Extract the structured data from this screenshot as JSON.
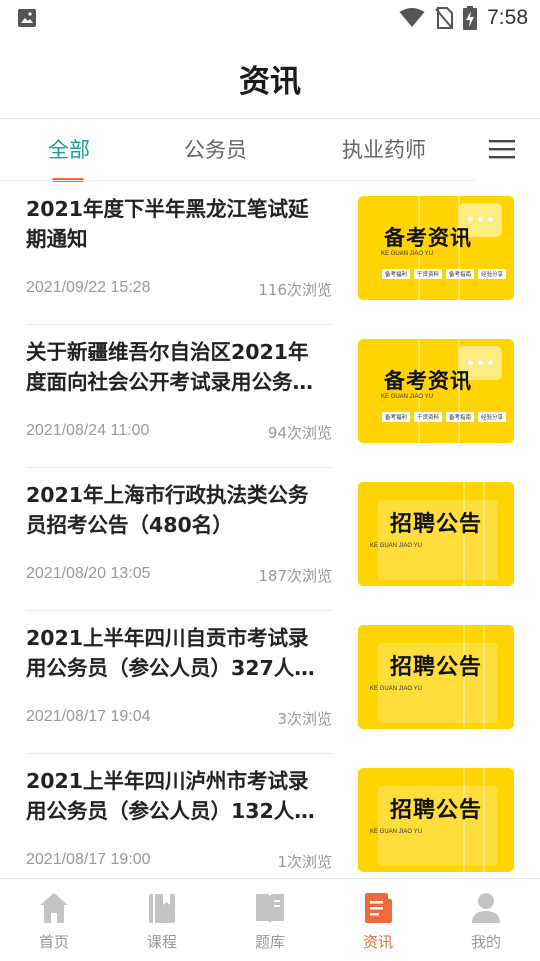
{
  "status_bar": {
    "time": "7:58"
  },
  "header": {
    "title": "资讯"
  },
  "tabs": [
    {
      "label": "全部",
      "active": true
    },
    {
      "label": "公务员",
      "active": false
    },
    {
      "label": "执业药师",
      "active": false
    }
  ],
  "articles": [
    {
      "title": "2021年度下半年黑龙江笔试延期通知",
      "date": "2021/09/22 15:28",
      "views": "116次浏览",
      "thumb": {
        "title": "备考资讯",
        "sub": "KE GUAN JIAO YU",
        "tags": [
          "备考福利",
          "干货资料",
          "备考指南",
          "经验分享"
        ]
      }
    },
    {
      "title": "关于新疆维吾尔自治区2021年度面向社会公开考试录用公务…",
      "date": "2021/08/24 11:00",
      "views": "94次浏览",
      "thumb": {
        "title": "备考资讯",
        "sub": "KE GUAN JIAO YU",
        "tags": [
          "备考福利",
          "干货资料",
          "备考指南",
          "经验分享"
        ]
      }
    },
    {
      "title": "2021年上海市行政执法类公务员招考公告（480名）",
      "date": "2021/08/20 13:05",
      "views": "187次浏览",
      "thumb": {
        "title": "招聘公告",
        "sub": "KE GUAN JIAO YU"
      }
    },
    {
      "title": "2021上半年四川自贡市考试录用公务员（参公人员）327人…",
      "date": "2021/08/17 19:04",
      "views": "3次浏览",
      "thumb": {
        "title": "招聘公告",
        "sub": "KE GUAN JIAO YU"
      }
    },
    {
      "title": "2021上半年四川泸州市考试录用公务员（参公人员）132人…",
      "date": "2021/08/17 19:00",
      "views": "1次浏览",
      "thumb": {
        "title": "招聘公告",
        "sub": "KE GUAN JIAO YU"
      }
    }
  ],
  "bottom_nav": [
    {
      "label": "首页",
      "icon": "home-icon",
      "active": false
    },
    {
      "label": "课程",
      "icon": "book-icon",
      "active": false
    },
    {
      "label": "题库",
      "icon": "open-book-icon",
      "active": false
    },
    {
      "label": "资讯",
      "icon": "news-icon",
      "active": true
    },
    {
      "label": "我的",
      "icon": "user-icon",
      "active": false
    }
  ],
  "colors": {
    "accent": "#ee6a3b",
    "tab_active": "#1f9e8f",
    "thumb_yellow": "#ffd400"
  }
}
